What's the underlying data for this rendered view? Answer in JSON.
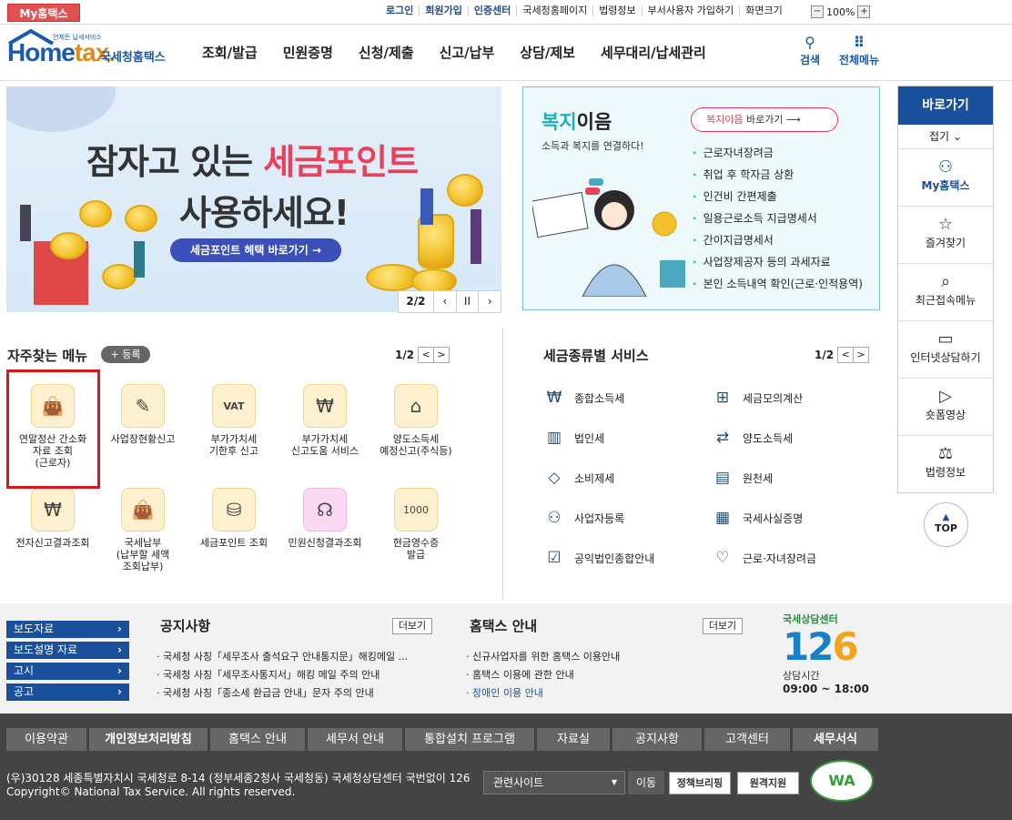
{
  "topbar": {
    "my_home": "My홈택스",
    "links": [
      "로그인",
      "회원가입",
      "인증센터",
      "국세청홈페이지",
      "법령정보",
      "부서사용자 가입하기",
      "화면크기"
    ],
    "zoom_minus": "−",
    "zoom_value": "100%",
    "zoom_plus": "+"
  },
  "header": {
    "logo_tiny": "언제든 납세서비스",
    "logo_home": "Home",
    "logo_tax": "tax.",
    "logo_sub": "국세청홈택스",
    "nav": [
      "조회/발급",
      "민원증명",
      "신청/제출",
      "신고/납부",
      "상담/제보",
      "세무대리/납세관리"
    ],
    "search_label": "검색",
    "all_menu_label": "전체메뉴"
  },
  "banner": {
    "line1_prefix": "잠자고 있는",
    "line1_highlight": "세금포인트",
    "line2": "사용하세요!",
    "button": "세금포인트 혜택 바로가기 →",
    "page": "2/2",
    "prev": "‹",
    "pause": "II",
    "next": "›"
  },
  "welfare": {
    "title_a": "복지",
    "title_b": "이음",
    "desc": "소득과 복지를 연결하다!",
    "btn_a": "복지이음",
    "btn_b": " 바로가기 ⟶",
    "items": [
      "근로자녀장려금",
      "취업 후 학자금 상환",
      "인건비 간편제출",
      "일용근로소득 지급명세서",
      "간이지급명세서",
      "사업장제공자 등의 과세자료",
      "본인 소득내역 확인(근로·인적용역)"
    ]
  },
  "quick": {
    "title": "바로가기",
    "fold": "접기 ⌄",
    "items": [
      "My홈택스",
      "즐겨찾기",
      "최근접속메뉴",
      "인터넷상담하기",
      "숏폼영상",
      "법령정보"
    ],
    "top": "TOP"
  },
  "freq": {
    "title": "자주찾는 메뉴",
    "add": "+ 등록",
    "page": "1/2",
    "prev": "<",
    "next": ">",
    "items": [
      {
        "label": "연말정산 간소화\n자료 조회\n(근로자)",
        "icon": "money-bag-icon"
      },
      {
        "label": "사업장현황신고",
        "icon": "form-pen-icon"
      },
      {
        "label": "부가가치세\n기한후 신고",
        "icon": "vat-doc-icon"
      },
      {
        "label": "부가가치세\n신고도움 서비스",
        "icon": "won-search-icon"
      },
      {
        "label": "양도소득세\n예정신고(주식등)",
        "icon": "house-icon"
      },
      {
        "label": "전자신고결과조회",
        "icon": "won-search-icon"
      },
      {
        "label": "국세납부\n(납부할 세액\n조회납부)",
        "icon": "money-bag-icon"
      },
      {
        "label": "세금포인트 조회",
        "icon": "tax-bag-icon"
      },
      {
        "label": "민원신청결과조회",
        "icon": "headset-icon"
      },
      {
        "label": "현금영수증\n발급",
        "icon": "cash-receipt-icon"
      }
    ]
  },
  "tax": {
    "title": "세금종류별 서비스",
    "page": "1/2",
    "prev": "<",
    "next": ">",
    "items": [
      {
        "label": "종합소득세",
        "icon": "won-hand-icon"
      },
      {
        "label": "세금모의계산",
        "icon": "calculator-icon"
      },
      {
        "label": "법인세",
        "icon": "building-icon"
      },
      {
        "label": "양도소득세",
        "icon": "transfer-doc-icon"
      },
      {
        "label": "소비제세",
        "icon": "diamond-icon"
      },
      {
        "label": "원천세",
        "icon": "sal-doc-icon"
      },
      {
        "label": "사업자등록",
        "icon": "person-icon"
      },
      {
        "label": "국세사실증명",
        "icon": "document-icon"
      },
      {
        "label": "공익법인종합안내",
        "icon": "clipboard-check-icon"
      },
      {
        "label": "근로·자녀장려금",
        "icon": "heart-hands-icon"
      }
    ]
  },
  "band": {
    "left_buttons": [
      "보도자료",
      "보도설명 자료",
      "고시",
      "공고"
    ],
    "notice_title": "공지사항",
    "notice_more": "더보기",
    "notices": [
      "국세청 사칭「세무조사 출석요구 안내통지문」해킹메일 ...",
      "국세청 사칭「세무조사통지서」해킹 메일 주의 안내",
      "국세청 사칭「종소세 환급금 안내」문자 주의 안내"
    ],
    "hometax_title": "홈택스 안내",
    "hometax_more": "더보기",
    "hometax_items": [
      "신규사업자를 위한 홈택스 이용안내",
      "홈택스 이용에 관한 안내",
      "장애인 이용 안내"
    ],
    "center_caption": "국세상담센터",
    "center_num_a": "12",
    "center_num_b": "6",
    "center_hours_label": "상담시간",
    "center_hours": "09:00 ~ 18:00"
  },
  "footer": {
    "nav": [
      "이용약관",
      "개인정보처리방침",
      "홈택스 안내",
      "세무서 안내",
      "통합설치 프로그램",
      "자료실",
      "공지사항",
      "고객센터",
      "세무서식"
    ],
    "address": "(우)30128 세종특별자치시 국세청로 8-14 (정부세종2청사 국세청동) 국세청상담센터 국번없이 126",
    "copyright": "Copyright© National Tax Service. All rights reserved.",
    "related_select": "관련사이트",
    "move": "이동",
    "btn1": "정책브리핑",
    "btn2": "원격지원",
    "wa_mark": "WA"
  }
}
